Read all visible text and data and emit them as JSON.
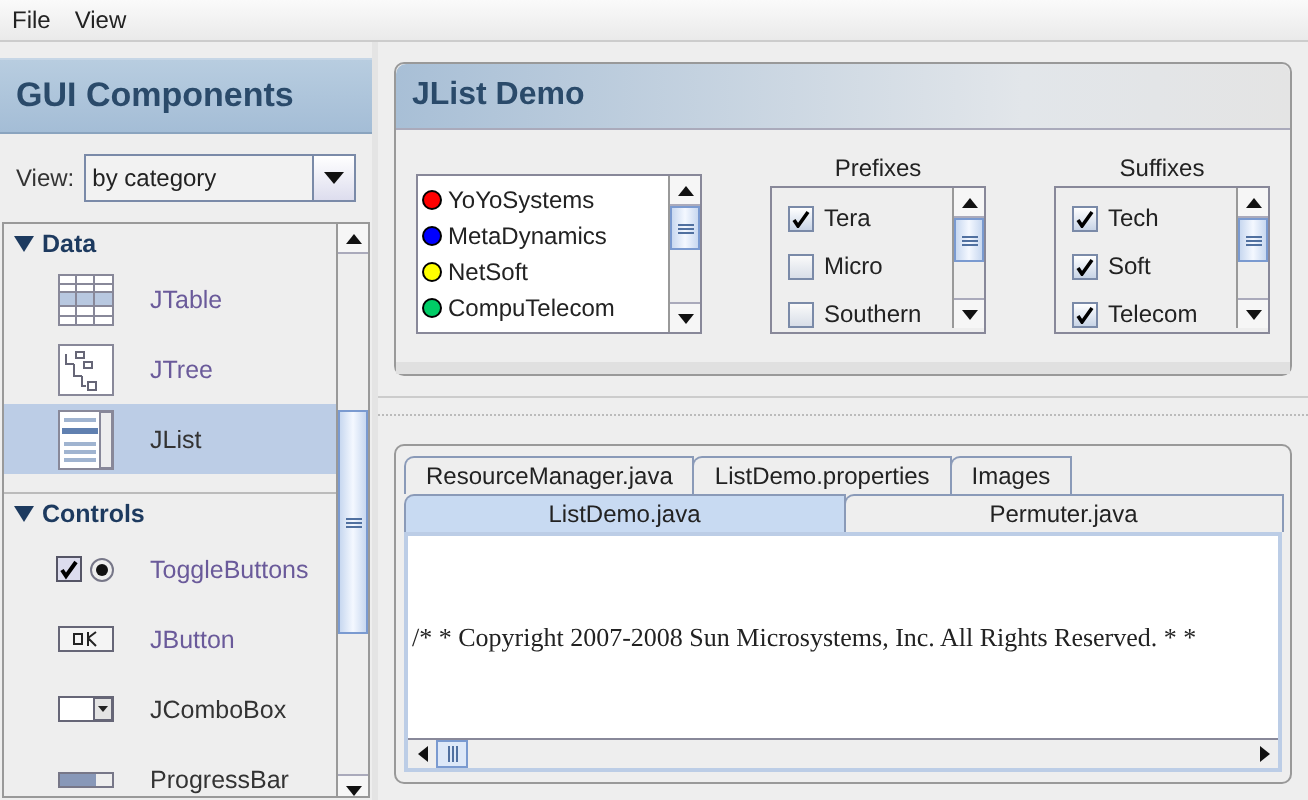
{
  "menu": [
    "File",
    "View"
  ],
  "sidebar": {
    "title": "GUI Components",
    "view_label": "View:",
    "view_value": "by category",
    "tree": [
      {
        "label": "Data",
        "expanded": true,
        "children": [
          {
            "label": "JTable",
            "kind": "table",
            "selected": false,
            "visited": true
          },
          {
            "label": "JTree",
            "kind": "tree",
            "selected": false,
            "visited": true
          },
          {
            "label": "JList",
            "kind": "list",
            "selected": true,
            "visited": false
          }
        ]
      },
      {
        "label": "Controls",
        "expanded": true,
        "children": [
          {
            "label": "ToggleButtons",
            "kind": "toggle",
            "selected": false,
            "visited": true
          },
          {
            "label": "JButton",
            "kind": "button",
            "selected": false,
            "visited": true
          },
          {
            "label": "JComboBox",
            "kind": "combo",
            "selected": false,
            "visited": false
          },
          {
            "label": "ProgressBar",
            "kind": "progress",
            "selected": false,
            "visited": false
          }
        ]
      }
    ]
  },
  "demo": {
    "title": "JList Demo",
    "companies": [
      {
        "name": "YoYoSystems",
        "color": "#ff0000"
      },
      {
        "name": "MetaDynamics",
        "color": "#0000ff"
      },
      {
        "name": "NetSoft",
        "color": "#ffff00"
      },
      {
        "name": "CompuTelecom",
        "color": "#00cc66"
      }
    ],
    "prefixes": {
      "title": "Prefixes",
      "items": [
        {
          "label": "Tera",
          "checked": true
        },
        {
          "label": "Micro",
          "checked": false
        },
        {
          "label": "Southern",
          "checked": false
        }
      ]
    },
    "suffixes": {
      "title": "Suffixes",
      "items": [
        {
          "label": "Tech",
          "checked": true
        },
        {
          "label": "Soft",
          "checked": true
        },
        {
          "label": "Telecom",
          "checked": true
        }
      ]
    }
  },
  "source": {
    "tab_rows": [
      [
        {
          "label": "ResourceManager.java",
          "selected": false
        },
        {
          "label": "ListDemo.properties",
          "selected": false
        },
        {
          "label": "Images",
          "selected": false
        }
      ],
      [
        {
          "label": "ListDemo.java",
          "selected": true
        },
        {
          "label": "Permuter.java",
          "selected": false
        }
      ]
    ],
    "text": "/* * Copyright 2007-2008 Sun Microsystems, Inc. All Rights Reserved. * *"
  }
}
